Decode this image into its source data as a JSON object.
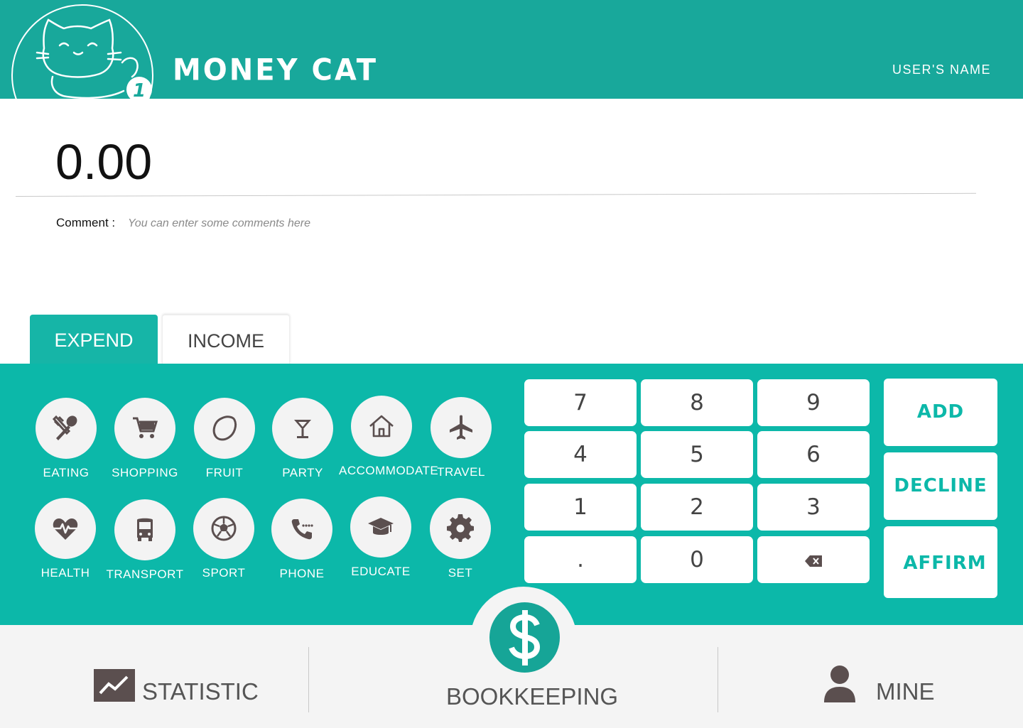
{
  "header": {
    "brand": "MONEY CAT",
    "user_name": "USER'S NAME"
  },
  "amount": {
    "value": "0.00"
  },
  "comment": {
    "label": "Comment :",
    "placeholder": "You can enter some comments here"
  },
  "tabs": [
    {
      "label": "EXPEND",
      "active": true
    },
    {
      "label": "INCOME",
      "active": false
    }
  ],
  "categories": [
    {
      "label": "EATING",
      "icon": "fork-spoon-icon"
    },
    {
      "label": "SHOPPING",
      "icon": "cart-icon"
    },
    {
      "label": "FRUIT",
      "icon": "lemon-icon"
    },
    {
      "label": "PARTY",
      "icon": "cocktail-icon"
    },
    {
      "label": "ACCOMMODATE",
      "icon": "house-icon"
    },
    {
      "label": "TRAVEL",
      "icon": "airplane-icon"
    },
    {
      "label": "HEALTH",
      "icon": "heartbeat-icon"
    },
    {
      "label": "TRANSPORT",
      "icon": "bus-icon"
    },
    {
      "label": "SPORT",
      "icon": "soccer-ball-icon"
    },
    {
      "label": "PHONE",
      "icon": "phone-icon"
    },
    {
      "label": "EDUCATE",
      "icon": "graduation-cap-icon"
    },
    {
      "label": "SET",
      "icon": "gear-icon"
    }
  ],
  "keypad": [
    "7",
    "8",
    "9",
    "4",
    "5",
    "6",
    "1",
    "2",
    "3",
    ".",
    "0",
    ""
  ],
  "actions": {
    "add": "ADD",
    "decline": "DECLINE",
    "affirm": "AFFIRM"
  },
  "nav": {
    "statistic": "STATISTIC",
    "bookkeeping": "BOOKKEEPING",
    "mine": "MINE"
  },
  "colors": {
    "header": "#18a89b",
    "panel": "#0cb8a9",
    "accent": "#16a597",
    "icon": "#5b4f4f"
  }
}
